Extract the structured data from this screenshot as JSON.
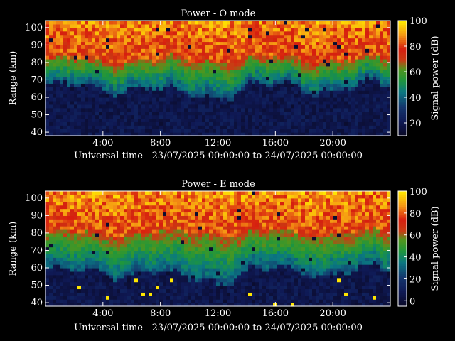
{
  "chart_data": [
    {
      "type": "heatmap",
      "title": "Power - O mode",
      "xlabel": "Universal time - 23/07/2025 00:00:00 to 24/07/2025 00:00:00",
      "ylabel": "Range (km)",
      "xlim": [
        0,
        24
      ],
      "ylim": [
        38,
        104
      ],
      "xticks": [
        "4:00",
        "8:00",
        "12:00",
        "16:00",
        "20:00"
      ],
      "yticks": [
        "40",
        "50",
        "60",
        "70",
        "80",
        "90",
        "100"
      ],
      "colorbar": {
        "label": "Signal power (dB)",
        "range": [
          10,
          100
        ],
        "ticks": [
          "20",
          "40",
          "60",
          "80",
          "100"
        ]
      },
      "profile": {
        "base_range_km": 66,
        "red_range_km": 82,
        "notes": "strong echoes (60-100 dB) above ~80 km, weak (<20 dB) below ~65 km"
      }
    },
    {
      "type": "heatmap",
      "title": "Power - E mode",
      "xlabel": "Universal time - 23/07/2025 00:00:00 to 24/07/2025 00:00:00",
      "ylabel": "Range (km)",
      "xlim": [
        0,
        24
      ],
      "ylim": [
        38,
        104
      ],
      "xticks": [
        "4:00",
        "8:00",
        "12:00",
        "16:00",
        "20:00"
      ],
      "yticks": [
        "40",
        "50",
        "60",
        "70",
        "80",
        "90",
        "100"
      ],
      "colorbar": {
        "label": "Signal power (dB)",
        "range": [
          -5,
          100
        ],
        "ticks": [
          "0",
          "20",
          "40",
          "60",
          "80",
          "100"
        ]
      },
      "profile": {
        "base_range_km": 58,
        "red_range_km": 80,
        "notes": "strong echoes above ~78 km, noise speckle below ~58 km"
      }
    }
  ]
}
